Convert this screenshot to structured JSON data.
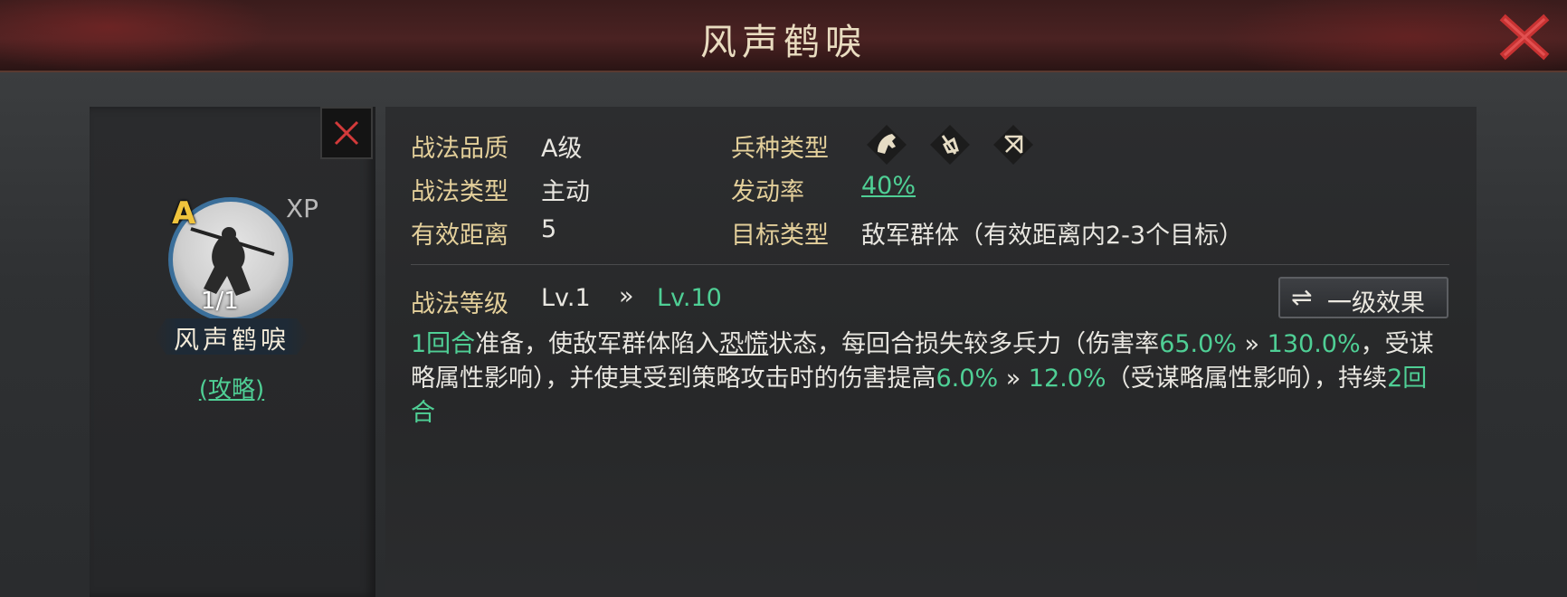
{
  "window": {
    "title": "风声鹤唳"
  },
  "card": {
    "grade": "A",
    "xp_label": "XP",
    "count": "1/1",
    "name": "风声鹤唳",
    "guide_link": "(攻略)"
  },
  "info": {
    "quality_label": "战法品质",
    "quality_value": "A级",
    "type_label": "战法类型",
    "type_value": "主动",
    "range_label": "有效距离",
    "range_value": "5",
    "troop_label": "兵种类型",
    "troop_icons": [
      "cavalry-icon",
      "spear-icon",
      "archer-icon"
    ],
    "rate_label": "发动率",
    "rate_value": "40%",
    "target_label": "目标类型",
    "target_value": "敌军群体（有效距离内2-3个目标）"
  },
  "level": {
    "label": "战法等级",
    "current": "Lv.1",
    "arrow": "»",
    "max": "Lv.10",
    "toggle_icon": "⇌",
    "toggle_label": "一级效果"
  },
  "description": {
    "rounds_prep": "1回合",
    "t1": "准备，使敌军群体陷入",
    "status": "恐慌",
    "t2": "状态，每回合损失较多兵力（伤害率",
    "dmg_from": "65.0%",
    "arrow1": " » ",
    "dmg_to": "130.0%",
    "t3": "，受谋略属性影响），并使其受到策略攻击时的伤害提高",
    "amp_from": "6.0%",
    "arrow2": " » ",
    "amp_to": "12.0%",
    "t4": "（受谋略属性影响），持续",
    "duration": "2回合"
  },
  "colors": {
    "highlight": "#4fcf95",
    "label": "#e3cf9a",
    "close": "#d23a3a"
  }
}
